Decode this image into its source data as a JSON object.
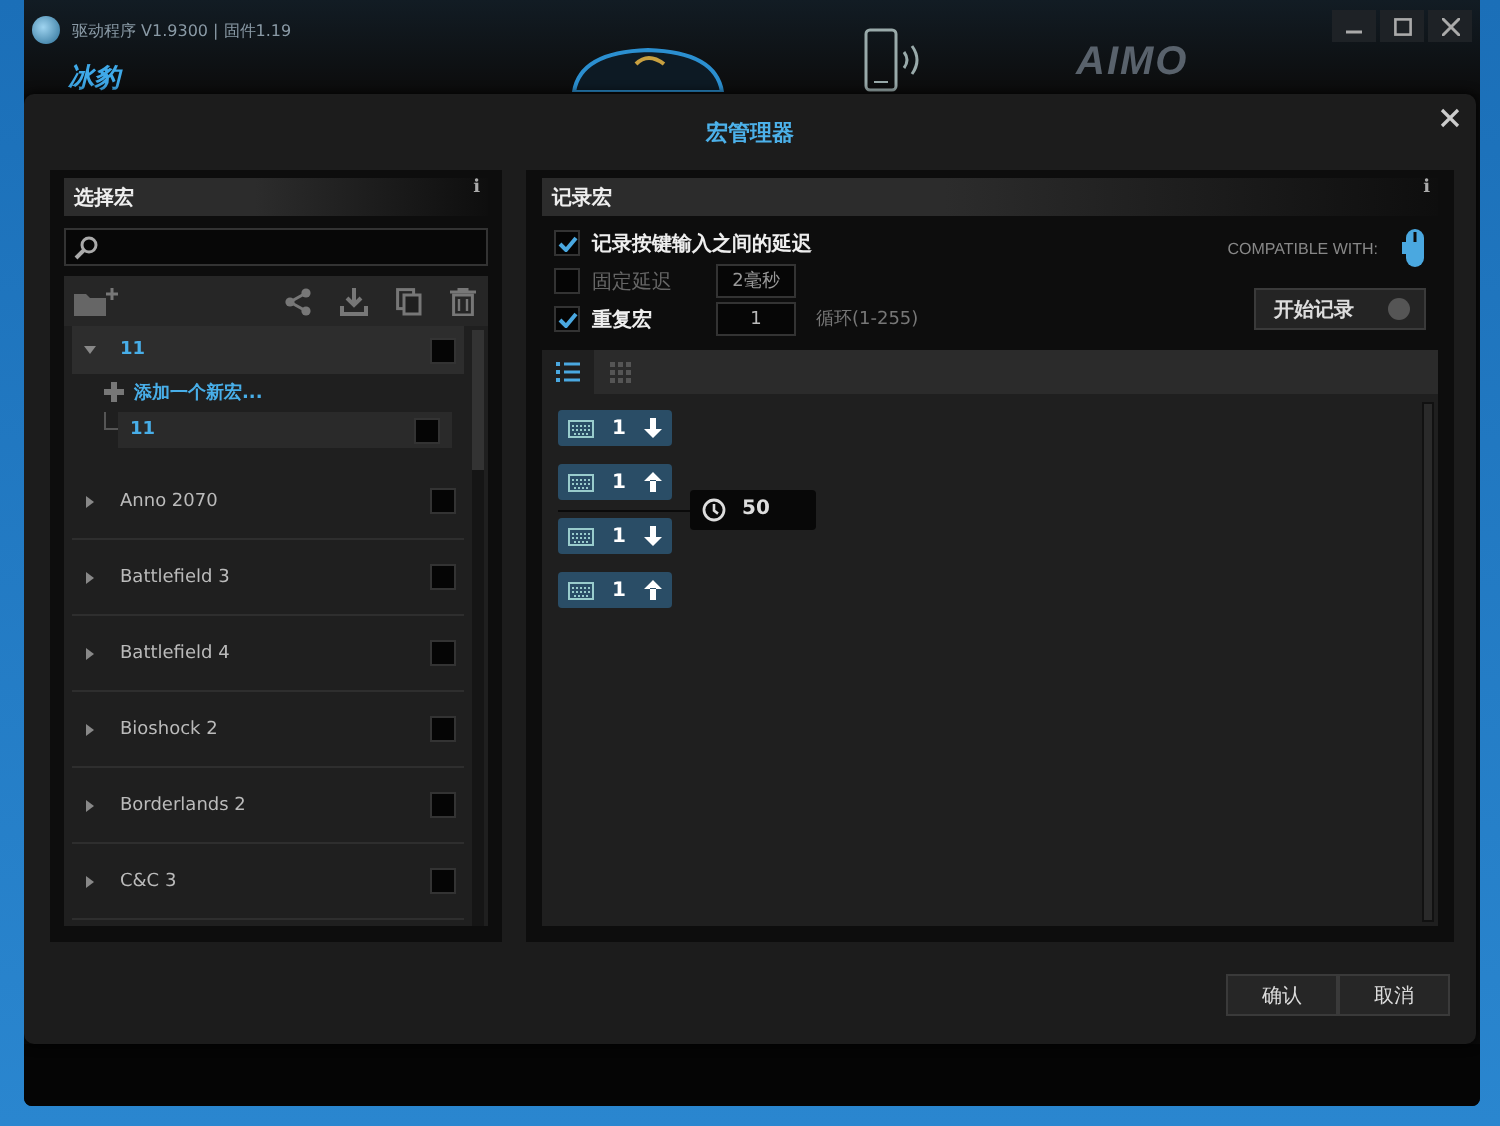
{
  "app": {
    "title": "驱动程序 V1.9300 | 固件1.19",
    "brand": "冰豹",
    "logo_text": "AIMO"
  },
  "dialog": {
    "title": "宏管理器",
    "left_panel": {
      "title": "选择宏",
      "info": "i",
      "groups": [
        {
          "name": "11",
          "expanded": true,
          "selected": true,
          "checked": false,
          "children": [
            {
              "kind": "add",
              "label": "添加一个新宏..."
            },
            {
              "kind": "macro",
              "name": "11",
              "checked": false
            }
          ]
        },
        {
          "name": "Anno 2070",
          "expanded": false,
          "selected": false,
          "checked": false
        },
        {
          "name": "Battlefield 3",
          "expanded": false,
          "selected": false,
          "checked": false
        },
        {
          "name": "Battlefield 4",
          "expanded": false,
          "selected": false,
          "checked": false
        },
        {
          "name": "Bioshock 2",
          "expanded": false,
          "selected": false,
          "checked": false
        },
        {
          "name": "Borderlands 2",
          "expanded": false,
          "selected": false,
          "checked": false
        },
        {
          "name": "C&C 3",
          "expanded": false,
          "selected": false,
          "checked": false
        }
      ]
    },
    "right_panel": {
      "title": "记录宏",
      "info": "i",
      "options": [
        {
          "kind": "checkbox",
          "label": "记录按键输入之间的延迟",
          "checked": true,
          "disabled": false
        },
        {
          "kind": "field",
          "label": "固定延迟",
          "checked": false,
          "disabled": true,
          "value": "2毫秒"
        },
        {
          "kind": "field",
          "label": "重复宏",
          "checked": true,
          "disabled": false,
          "value": "1",
          "suffix": "循环(1-255)"
        }
      ],
      "compatible": "COMPATIBLE WITH:",
      "record_button": {
        "label": "开始记录",
        "on": false
      },
      "view_tabs": [
        {
          "kind": "list",
          "selected": true
        },
        {
          "kind": "grid",
          "selected": false
        }
      ],
      "events": [
        {
          "kind": "key",
          "key": "1",
          "released": false
        },
        {
          "kind": "key",
          "key": "1",
          "released": true
        },
        {
          "kind": "delay",
          "value": "50"
        },
        {
          "kind": "key",
          "key": "1",
          "released": false
        },
        {
          "kind": "key",
          "key": "1",
          "released": true
        }
      ]
    },
    "buttons": [
      "确认",
      "取消"
    ]
  }
}
